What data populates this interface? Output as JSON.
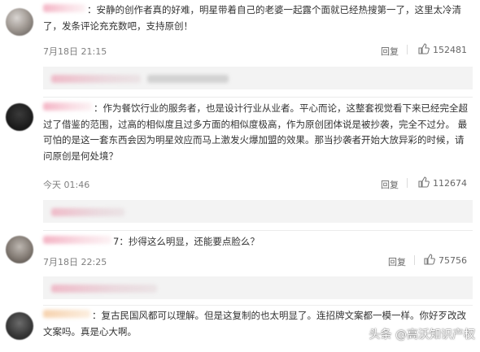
{
  "comments": [
    {
      "text": "：安静的创作者真的好难，明星带着自己的老婆一起露个面就已经热搜第一了，这里太冷清了，发条评论充充数吧，支持原创！",
      "time": "7月18日 21:15",
      "reply_label": "回复",
      "likes": "152481"
    },
    {
      "text": "：作为餐饮行业的服务者，也是设计行业从业者。平心而论，这整套视觉看下来已经完全超过了借鉴的范围，过高的相似度且过多方面的相似度极高，作为原创团体说是被抄袭，完全不过分。 最可怕的是这一套东西会因为明星效应而马上激发火爆加盟的效果。那当抄袭者开始大放异彩的时候，请问原创是何处境？",
      "time": "今天 01:46",
      "reply_label": "回复",
      "likes": "112674"
    },
    {
      "text": "7：抄得这么明显，还能要点脸么？",
      "time": "7月18日 22:25",
      "reply_label": "回复",
      "likes": "75756"
    },
    {
      "text": "：复古民国风都可以理解。但是这复制的也太明显了。连招牌文案都一模一样。你好歹改改文案吗。真是心大啊。",
      "time": "",
      "reply_label": "回复",
      "likes": ""
    }
  ],
  "watermark": "头条 @高沃知识产权",
  "colors": {
    "text": "#333333",
    "meta": "#808080",
    "reply_bg": "#f3f3f3"
  }
}
